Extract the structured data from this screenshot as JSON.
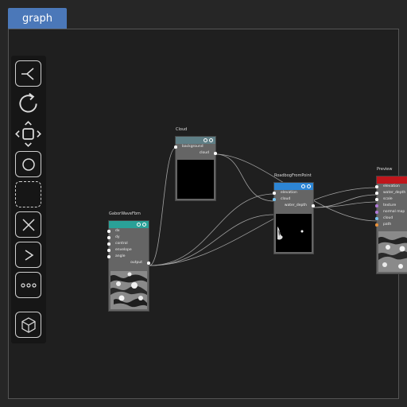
{
  "tab": {
    "label": "graph"
  },
  "toolbar": {
    "tools": [
      "connect-tool",
      "rotate-tool",
      "move-tool",
      "circle-select-tool",
      "rect-select-tool",
      "delete-tool",
      "run-tool",
      "more-tool",
      "3d-view-tool"
    ]
  },
  "nodes": {
    "cloud": {
      "title": "Cloud",
      "header_color": "#5f7f86",
      "inputs": [
        "background"
      ],
      "outputs": [
        "cloud"
      ]
    },
    "gabor": {
      "title": "GaborWaveFbm",
      "header_color": "#2aa198",
      "inputs": [
        "dx",
        "dy",
        "control",
        "envelope",
        "angle"
      ],
      "outputs": [
        "output"
      ]
    },
    "roadbog": {
      "title": "RoadbogFromPoint",
      "header_color": "#2d85d4",
      "inputs": [
        "elevation",
        "cloud"
      ],
      "outputs": [
        "water_depth"
      ]
    },
    "preview": {
      "title": "Preview",
      "header_color": "#c0161b",
      "inputs": [
        "elevation",
        "water_depth",
        "scale",
        "texture",
        "normal map",
        "cloud",
        "path"
      ]
    }
  },
  "colors": {
    "tab": "#4b78b9",
    "canvas": "#1f1f1f",
    "port_purple": "#b07ad8",
    "port_orange": "#e8913a",
    "port_blue": "#79c3ee"
  }
}
